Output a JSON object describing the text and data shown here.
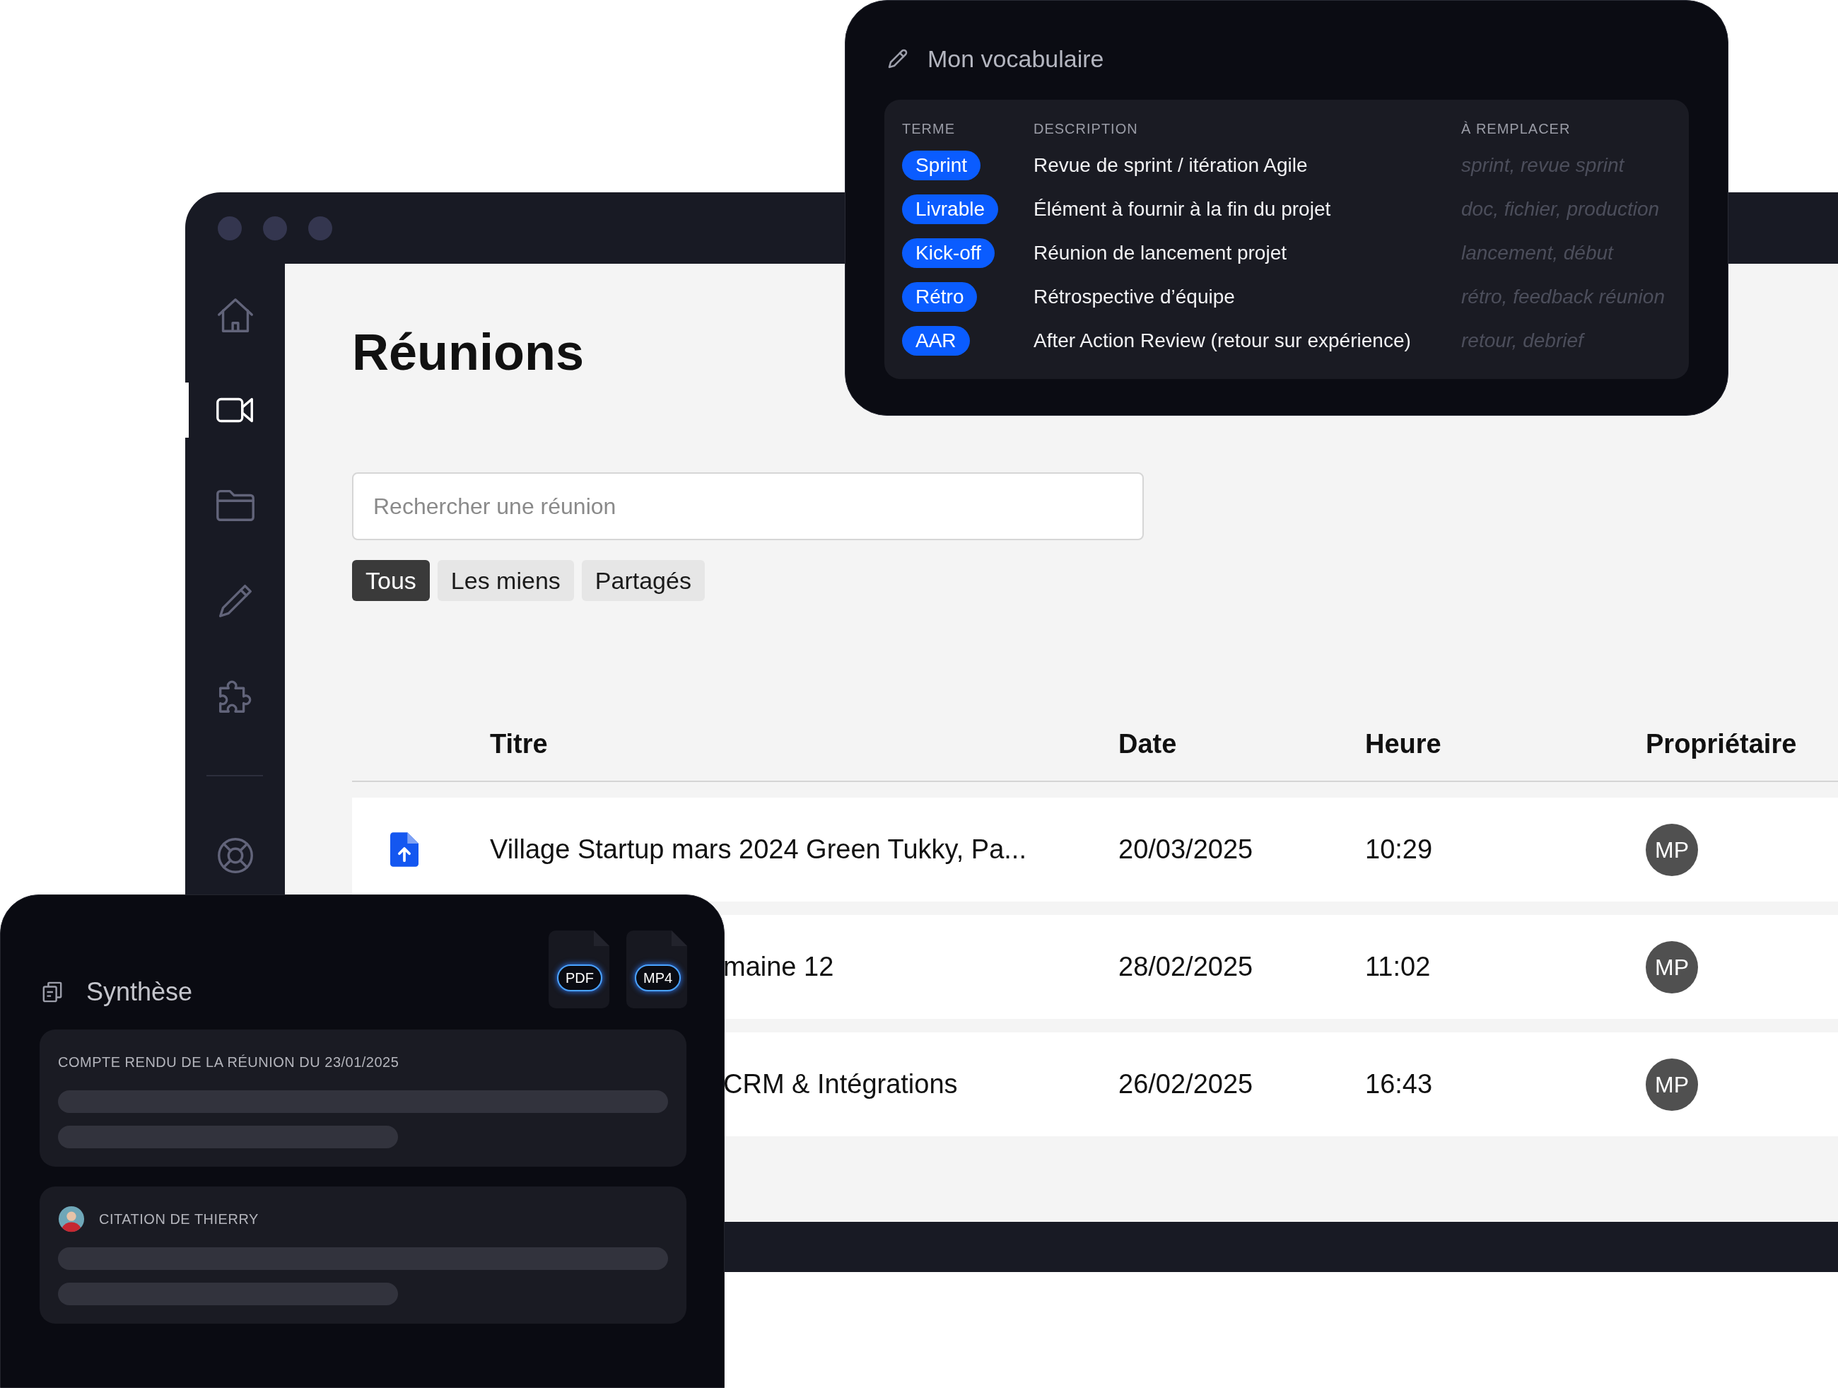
{
  "main_window": {
    "sidebar": {
      "items": [
        {
          "selected": false
        },
        {
          "selected": true
        },
        {
          "selected": false
        },
        {
          "selected": false
        },
        {
          "selected": false
        },
        {
          "selected": false
        }
      ]
    },
    "page_title": "Réunions",
    "search": {
      "placeholder": "Rechercher une réunion"
    },
    "filters": [
      {
        "label": "Tous",
        "selected": true
      },
      {
        "label": "Les miens",
        "selected": false
      },
      {
        "label": "Partagés",
        "selected": false
      }
    ],
    "table": {
      "columns": [
        "Titre",
        "Date",
        "Heure",
        "Propriétaire"
      ],
      "rows": [
        {
          "kind": "full",
          "title": "Village Startup mars 2024 Green Tukky, Pa...",
          "date": "20/03/2025",
          "time": "10:29",
          "owner": "MP"
        },
        {
          "kind": "covered",
          "title": "maine 12",
          "date": "28/02/2025",
          "time": "11:02",
          "owner": "MP"
        },
        {
          "kind": "covered",
          "title": "CRM & Intégrations",
          "date": "26/02/2025",
          "time": "16:43",
          "owner": "MP"
        }
      ]
    }
  },
  "vocabulary": {
    "title": "Mon vocabulaire",
    "columns": [
      "TERME",
      "DESCRIPTION",
      "À REMPLACER"
    ],
    "rows": [
      {
        "term": "Sprint",
        "description": "Revue de sprint / itération Agile",
        "replace": "sprint, revue sprint"
      },
      {
        "term": "Livrable",
        "description": "Élément à fournir à la fin du projet",
        "replace": "doc, fichier, production"
      },
      {
        "term": "Kick-off",
        "description": "Réunion de lancement projet",
        "replace": "lancement, début"
      },
      {
        "term": "Rétro",
        "description": "Rétrospective d’équipe",
        "replace": "rétro, feedback réunion"
      },
      {
        "term": "AAR",
        "description": "After Action Review (retour sur expérience)",
        "replace": "retour, debrief"
      }
    ]
  },
  "synthesis": {
    "title": "Synthèse",
    "files": [
      "PDF",
      "MP4"
    ],
    "cards": [
      {
        "kind": "summary",
        "label": "COMPTE RENDU DE LA RÉUNION DU 23/01/2025"
      },
      {
        "kind": "quote",
        "label": "CITATION DE THIERRY"
      }
    ]
  }
}
